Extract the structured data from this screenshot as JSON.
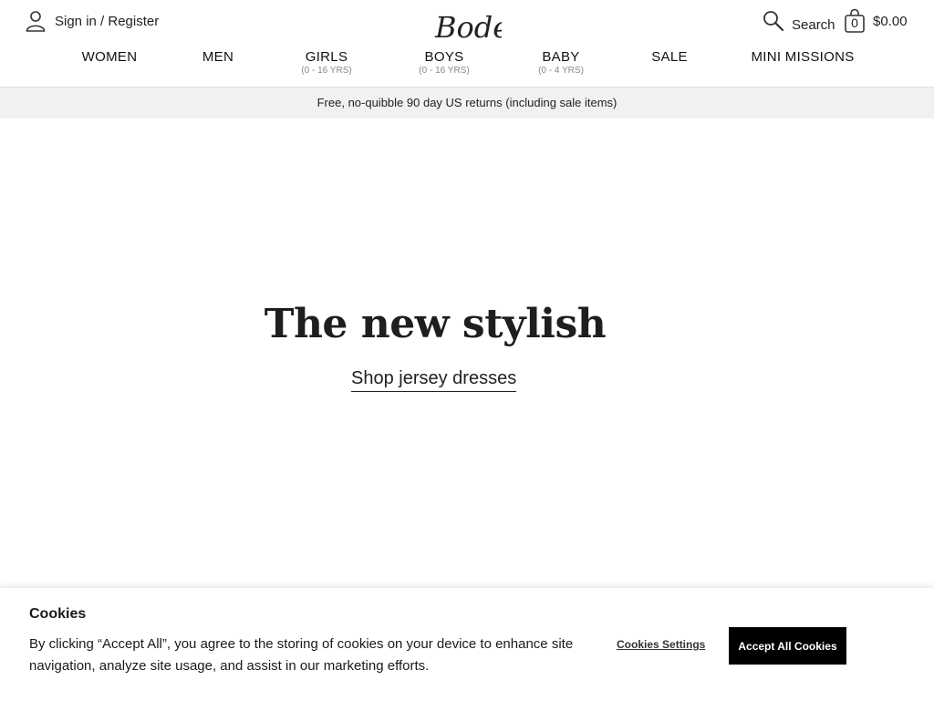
{
  "header": {
    "signin_label": "Sign in / Register",
    "logo_text": "Boden",
    "search_label": "Search",
    "basket_count": "0",
    "basket_total": "$0.00"
  },
  "nav": [
    {
      "label": "WOMEN",
      "sub": ""
    },
    {
      "label": "MEN",
      "sub": ""
    },
    {
      "label": "GIRLS",
      "sub": "(0 - 16 YRS)"
    },
    {
      "label": "BOYS",
      "sub": "(0 - 16 YRS)"
    },
    {
      "label": "BABY",
      "sub": "(0 - 4 YRS)"
    },
    {
      "label": "SALE",
      "sub": ""
    },
    {
      "label": "MINI MISSIONS",
      "sub": ""
    }
  ],
  "promo": {
    "text": "Free, no-quibble 90 day US returns (including sale items)"
  },
  "hero": {
    "title": "The new stylish",
    "cta": "Shop jersey dresses"
  },
  "cookies": {
    "title": "Cookies",
    "body": "By clicking “Accept All”, you agree to the storing of cookies on your device to enhance site navigation, analyze site usage, and assist in our marketing efforts.",
    "settings_label": "Cookies Settings",
    "accept_label": "Accept All Cookies"
  }
}
